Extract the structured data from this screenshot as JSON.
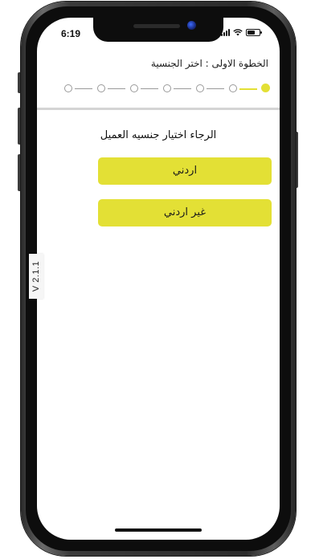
{
  "status_bar": {
    "time": "6:19"
  },
  "header": {
    "step_title": "الخطوة الاولى : اختر الجنسية"
  },
  "stepper": {
    "total_steps": 7,
    "current_step": 1
  },
  "main": {
    "prompt": "الرجاء اختيار جنسيه العميل",
    "options": [
      {
        "label": "اردني"
      },
      {
        "label": "غير اردني"
      }
    ]
  },
  "version_label": "V 2.1.1",
  "colors": {
    "accent": "#e3e035",
    "inactive": "#9a9a9a",
    "divider": "#d4d4d4"
  }
}
